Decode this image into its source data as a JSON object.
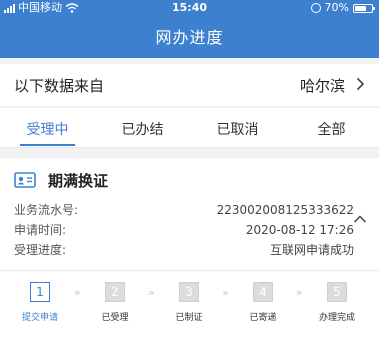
{
  "status_bar": {
    "carrier": "中国移动",
    "time": "15:40",
    "battery": "70%",
    "battery_level": 0.7
  },
  "header": {
    "title": "网办进度"
  },
  "source": {
    "label": "以下数据来自",
    "city": "哈尔滨"
  },
  "tabs": [
    {
      "label": "受理中",
      "active": true
    },
    {
      "label": "已办结",
      "active": false
    },
    {
      "label": "已取消",
      "active": false
    },
    {
      "label": "全部",
      "active": false
    }
  ],
  "card": {
    "title": "期满换证",
    "fields": [
      {
        "label": "业务流水号:",
        "value": "223002008125333622"
      },
      {
        "label": "申请时间:",
        "value": "2020-08-12 17:26"
      },
      {
        "label": "受理进度:",
        "value": "互联网申请成功"
      }
    ],
    "steps": [
      {
        "num": "1",
        "label": "提交申请",
        "active": true
      },
      {
        "num": "2",
        "label": "已受理",
        "active": false
      },
      {
        "num": "3",
        "label": "已制证",
        "active": false
      },
      {
        "num": "4",
        "label": "已寄递",
        "active": false
      },
      {
        "num": "5",
        "label": "办理完成",
        "active": false
      }
    ],
    "step_separator": "»"
  },
  "colors": {
    "accent": "#3d80cf",
    "inactive_step": "#dcdcdc",
    "background": "#f2f2f2"
  },
  "icons": [
    "signal-icon",
    "wifi-icon",
    "alarm-icon",
    "battery-icon",
    "chevron-right-icon",
    "id-card-icon",
    "chevron-up-icon"
  ]
}
